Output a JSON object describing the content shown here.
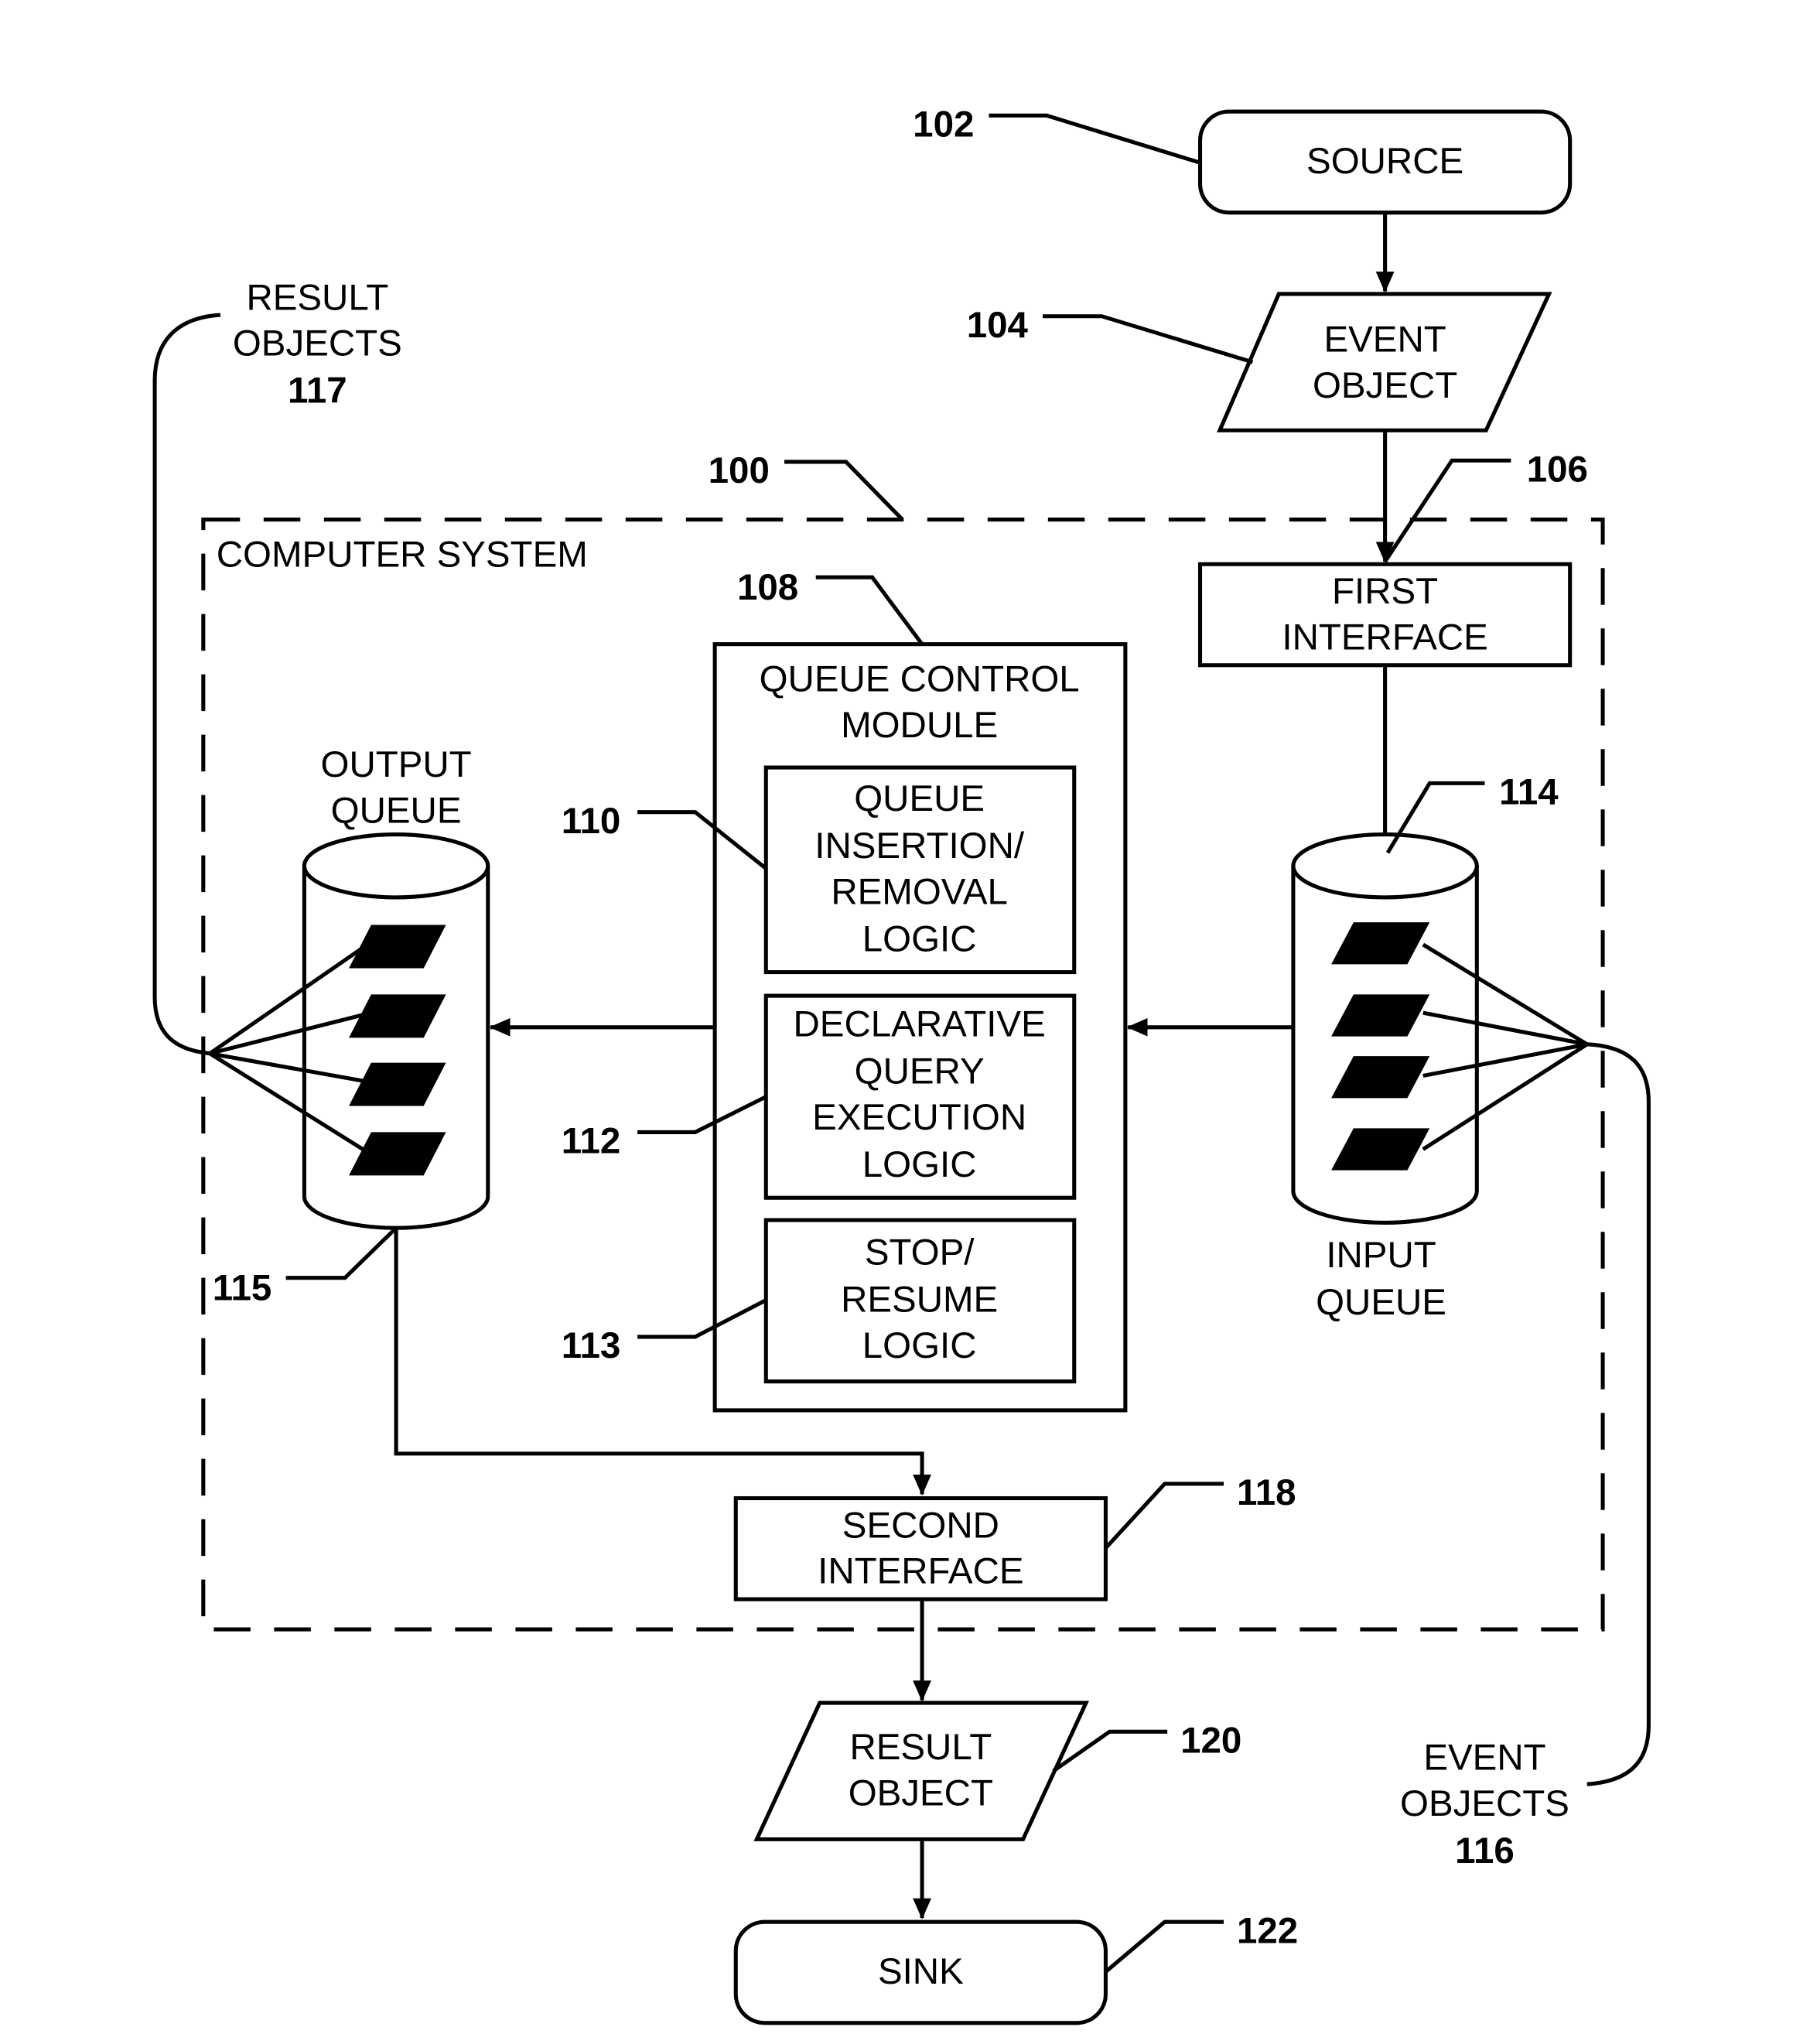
{
  "diagram": {
    "container": {
      "label": "COMPUTER SYSTEM",
      "ref": "100"
    },
    "source": {
      "label": "SOURCE",
      "ref": "102"
    },
    "event_object": {
      "lines": [
        "EVENT",
        "OBJECT"
      ],
      "ref": "104"
    },
    "first_interface": {
      "lines": [
        "FIRST",
        "INTERFACE"
      ],
      "ref": "106"
    },
    "queue_control_module": {
      "lines": [
        "QUEUE CONTROL",
        "MODULE"
      ],
      "ref": "108",
      "submodules": [
        {
          "lines": [
            "QUEUE",
            "INSERTION/",
            "REMOVAL",
            "LOGIC"
          ],
          "ref": "110"
        },
        {
          "lines": [
            "DECLARATIVE",
            "QUERY",
            "EXECUTION",
            "LOGIC"
          ],
          "ref": "112"
        },
        {
          "lines": [
            "STOP/",
            "RESUME",
            "LOGIC"
          ],
          "ref": "113"
        }
      ]
    },
    "input_queue": {
      "lines": [
        "INPUT",
        "QUEUE"
      ],
      "ref": "114",
      "item_count": 4
    },
    "output_queue": {
      "lines": [
        "OUTPUT",
        "QUEUE"
      ],
      "ref": "115",
      "item_count": 4
    },
    "event_objects": {
      "lines": [
        "EVENT",
        "OBJECTS"
      ],
      "ref": "116"
    },
    "result_objects": {
      "lines": [
        "RESULT",
        "OBJECTS"
      ],
      "ref": "117"
    },
    "second_interface": {
      "lines": [
        "SECOND",
        "INTERFACE"
      ],
      "ref": "118"
    },
    "result_object": {
      "lines": [
        "RESULT",
        "OBJECT"
      ],
      "ref": "120"
    },
    "sink": {
      "label": "SINK",
      "ref": "122"
    }
  }
}
